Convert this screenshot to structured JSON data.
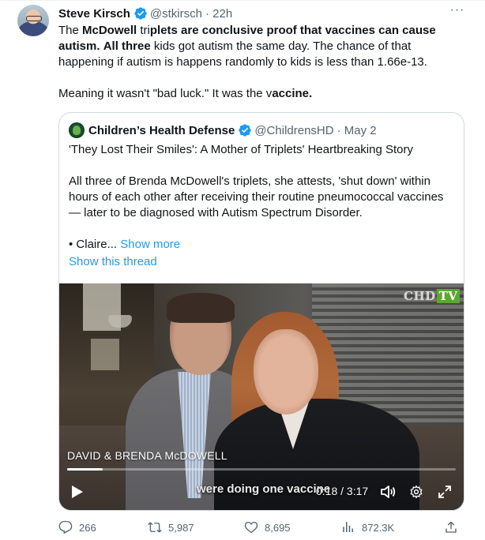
{
  "tweet": {
    "author_name": "Steve Kirsch",
    "author_handle": "@stkirsch",
    "time": "· 22h",
    "more_label": "···",
    "text": {
      "s1": "The ",
      "s2": "McDowell",
      "s3": " tri",
      "s4": "plets are conclusive proof that vaccines can cause autism.",
      "s5": " ",
      "s6": "All three",
      "s7": " kids got autism the same day. The chance of that happening if autism is happens randomly to kids is less than 1.66e-13.",
      "p2a": "Meaning it wasn't \"bad luck.\" It was the v",
      "p2b": "accine."
    }
  },
  "quoted": {
    "author_name": "Children’s Health Defense",
    "author_handle": "@ChildrensHD",
    "time": "· May 2",
    "title": "'They Lost Their Smiles': A Mother of Triplets' Heartbreaking Story",
    "body": "All three of Brenda McDowell's triplets, she attests, 'shut down' within hours of each other after receiving their routine pneumococcal vaccines — later to be diagnosed with Autism Spectrum Disorder.",
    "teaser": "• Claire...",
    "show_more": "Show more",
    "show_thread": "Show this thread"
  },
  "video": {
    "logo_chd": "CHD",
    "logo_tv": "TV",
    "caption_name": "DAVID & BRENDA McDOWELL",
    "subtitle": "were doing one vaccine",
    "time_display": "0:18 / 3:17",
    "progress_fraction": 0.092
  },
  "actions": {
    "replies": "266",
    "retweets": "5,987",
    "likes": "8,695",
    "views": "872.3K"
  },
  "colors": {
    "accent": "#1d9bf0",
    "text": "#0f1419",
    "muted": "#536471",
    "border": "#cfd9de",
    "verified": "#1d9bf0",
    "chd_green": "#5aa832"
  }
}
